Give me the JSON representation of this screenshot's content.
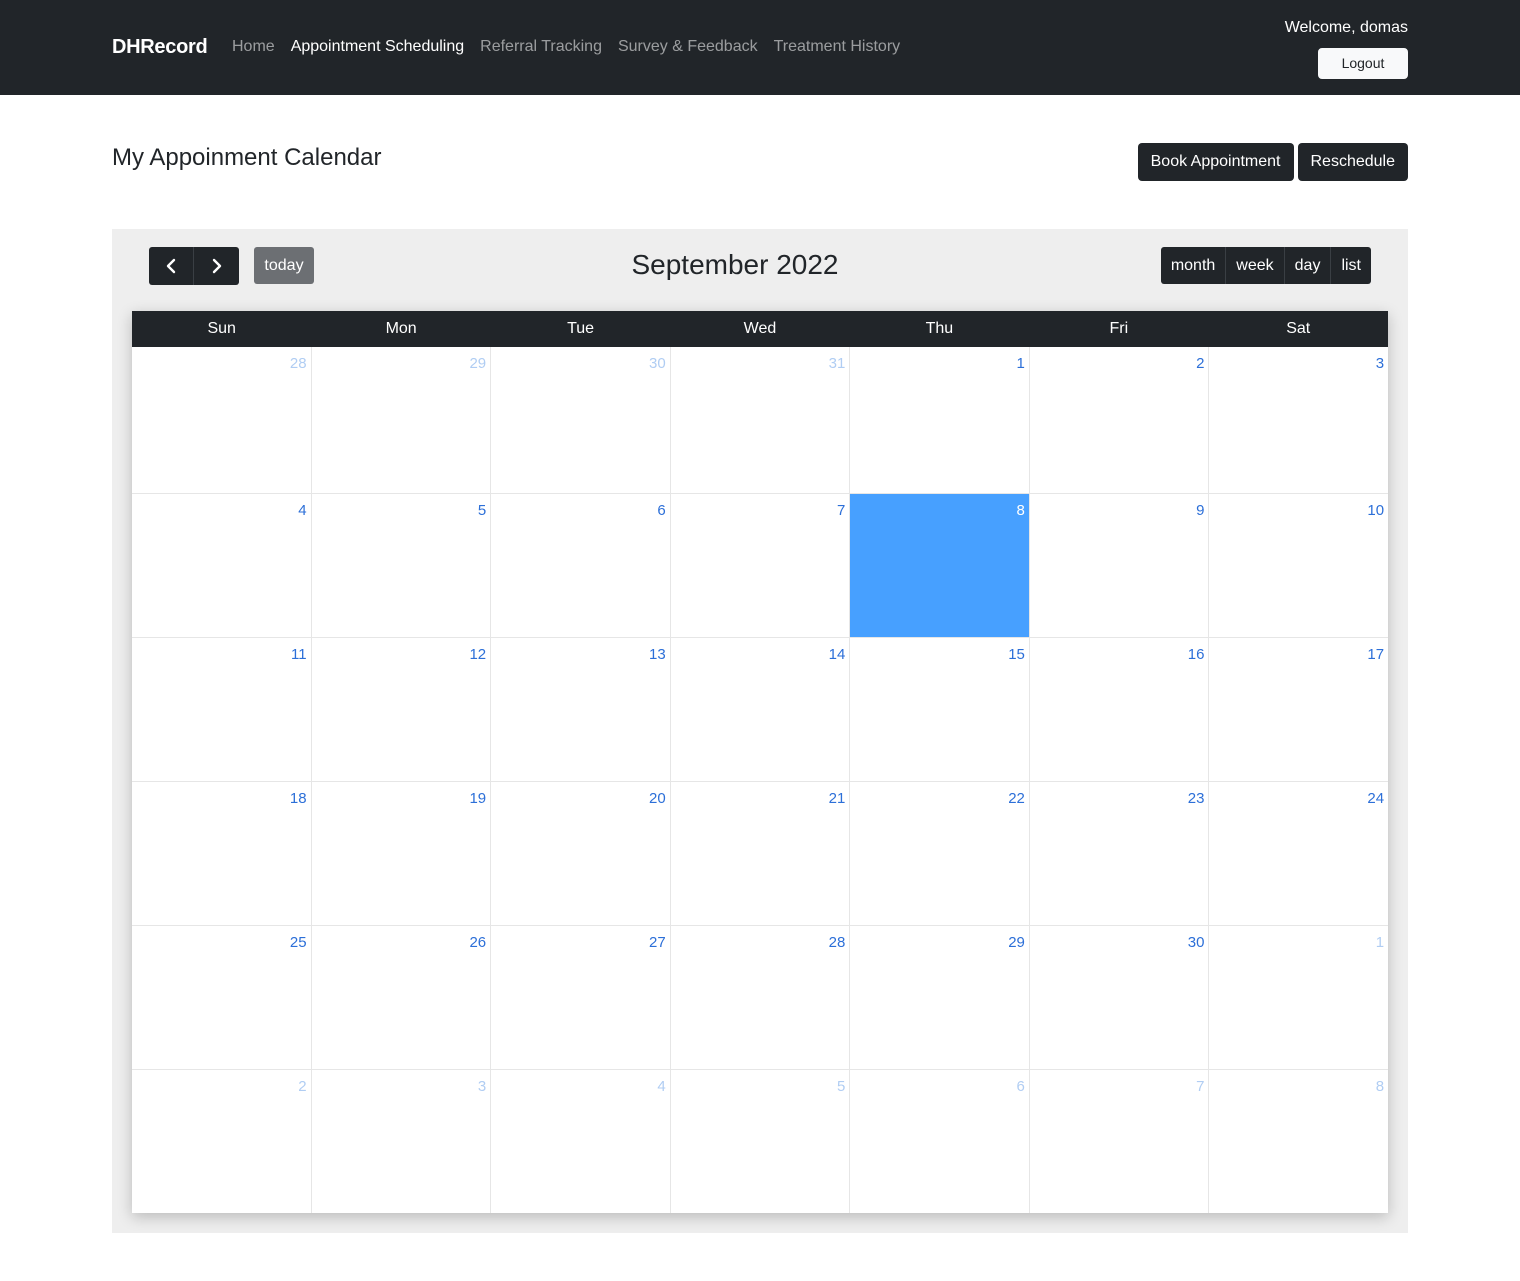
{
  "navbar": {
    "brand": "DHRecord",
    "links": [
      {
        "label": "Home",
        "active": false
      },
      {
        "label": "Appointment Scheduling",
        "active": true
      },
      {
        "label": "Referral Tracking",
        "active": false
      },
      {
        "label": "Survey & Feedback",
        "active": false
      },
      {
        "label": "Treatment History",
        "active": false
      }
    ],
    "welcome": "Welcome, domas",
    "logout_label": "Logout"
  },
  "page": {
    "title": "My Appoinment Calendar",
    "book_label": "Book Appointment",
    "reschedule_label": "Reschedule"
  },
  "calendar": {
    "prev_icon": "chevron-left-icon",
    "next_icon": "chevron-right-icon",
    "today_label": "today",
    "title": "September 2022",
    "views": [
      "month",
      "week",
      "day",
      "list"
    ],
    "day_headers": [
      "Sun",
      "Mon",
      "Tue",
      "Wed",
      "Thu",
      "Fri",
      "Sat"
    ],
    "weeks": [
      [
        {
          "n": "28",
          "other": true
        },
        {
          "n": "29",
          "other": true
        },
        {
          "n": "30",
          "other": true
        },
        {
          "n": "31",
          "other": true
        },
        {
          "n": "1"
        },
        {
          "n": "2"
        },
        {
          "n": "3"
        }
      ],
      [
        {
          "n": "4"
        },
        {
          "n": "5"
        },
        {
          "n": "6"
        },
        {
          "n": "7"
        },
        {
          "n": "8",
          "today": true
        },
        {
          "n": "9"
        },
        {
          "n": "10"
        }
      ],
      [
        {
          "n": "11"
        },
        {
          "n": "12"
        },
        {
          "n": "13"
        },
        {
          "n": "14"
        },
        {
          "n": "15"
        },
        {
          "n": "16"
        },
        {
          "n": "17"
        }
      ],
      [
        {
          "n": "18"
        },
        {
          "n": "19"
        },
        {
          "n": "20"
        },
        {
          "n": "21"
        },
        {
          "n": "22"
        },
        {
          "n": "23"
        },
        {
          "n": "24"
        }
      ],
      [
        {
          "n": "25"
        },
        {
          "n": "26"
        },
        {
          "n": "27"
        },
        {
          "n": "28"
        },
        {
          "n": "29"
        },
        {
          "n": "30"
        },
        {
          "n": "1",
          "other": true
        }
      ],
      [
        {
          "n": "2",
          "other": true
        },
        {
          "n": "3",
          "other": true
        },
        {
          "n": "4",
          "other": true
        },
        {
          "n": "5",
          "other": true
        },
        {
          "n": "6",
          "other": true
        },
        {
          "n": "7",
          "other": true
        },
        {
          "n": "8",
          "other": true
        }
      ]
    ],
    "colors": {
      "day_number": "#2c6fd8",
      "other_month_number": "#b0cdf3",
      "today_highlight": "#47a0ff",
      "header_bg": "#212529"
    }
  }
}
